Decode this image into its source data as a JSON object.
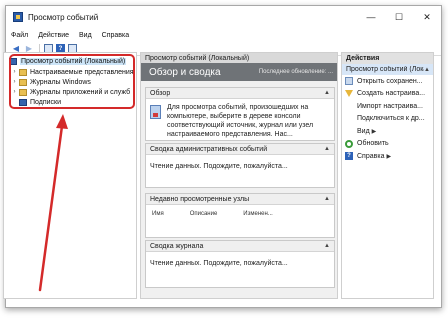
{
  "window": {
    "title": "Просмотр событий",
    "min": "—",
    "max": "☐",
    "close": "✕"
  },
  "menu": [
    "Файл",
    "Действие",
    "Вид",
    "Справка"
  ],
  "tree": {
    "root": "Просмотр событий (Локальный)",
    "items": [
      "Настраиваемые представления",
      "Журналы Windows",
      "Журналы приложений и служб",
      "Подписки"
    ]
  },
  "center": {
    "header": "Просмотр событий (Локальный)",
    "banner_title": "Обзор и сводка",
    "banner_note": "Последнее обновление: ...",
    "overview": {
      "title": "Обзор",
      "text": "Для просмотра событий, произошедших на компьютере, выберите в дереве консоли соответствующий источник, журнал или узел настраиваемого представления. Нас..."
    },
    "admin_summary": {
      "title": "Сводка административных событий",
      "text": "Чтение данных. Подождите, пожалуйста..."
    },
    "recent_nodes": {
      "title": "Недавно просмотренные узлы",
      "columns": [
        "Имя",
        "Описание",
        "Изменен..."
      ]
    },
    "log_summary": {
      "title": "Сводка журнала",
      "text": "Чтение данных. Подождите, пожалуйста..."
    }
  },
  "actions": {
    "title": "Действия",
    "section": "Просмотр событий (Локальный)",
    "items": [
      {
        "label": "Открыть сохранен...",
        "icon": "open-saved-log-icon"
      },
      {
        "label": "Создать настраива...",
        "icon": "filter-icon"
      },
      {
        "label": "Импорт настраива...",
        "icon": ""
      },
      {
        "label": "Подключиться к др...",
        "icon": ""
      },
      {
        "label": "Вид",
        "icon": ""
      },
      {
        "label": "Обновить",
        "icon": "refresh-icon"
      },
      {
        "label": "Справка",
        "icon": "help-icon"
      }
    ]
  },
  "colors": {
    "accent": "#cce4f7",
    "banner": "#6f7377",
    "highlight": "#d42a2a"
  }
}
